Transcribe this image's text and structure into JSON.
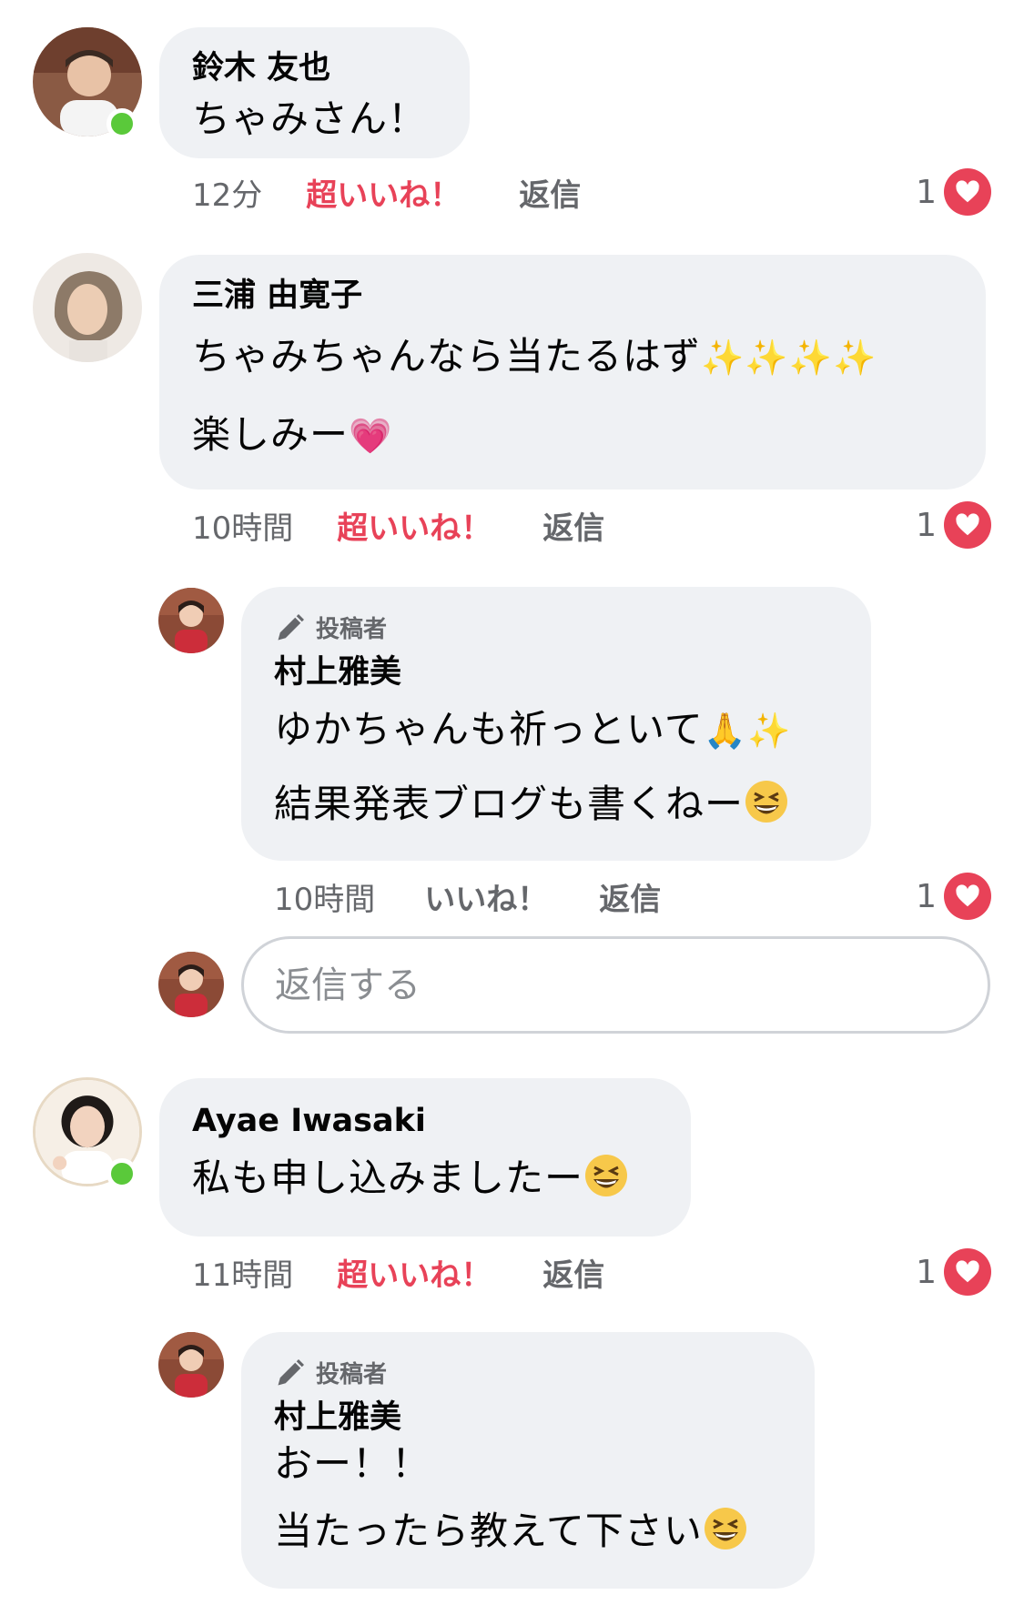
{
  "colors": {
    "like_accent": "#e84258",
    "online": "#5ac93a",
    "bubble": "#eff1f4",
    "muted": "#65676b"
  },
  "comments": [
    {
      "name": "鈴木 友也",
      "lines": [
        "ちゃみさん！"
      ],
      "time": "12分",
      "like_label": "超いいね！",
      "reply_label": "返信",
      "reaction_count": "1"
    },
    {
      "name": "三浦 由寛子",
      "lines": [
        "ちゃみちゃんなら当たるはず",
        "楽しみー"
      ],
      "time": "10時間",
      "like_label": "超いいね！",
      "reply_label": "返信",
      "reaction_count": "1"
    },
    {
      "badge": "投稿者",
      "name": "村上雅美",
      "lines": [
        "ゆかちゃんも祈っといて",
        "結果発表ブログも書くねー"
      ],
      "time": "10時間",
      "like_label": "いいね！",
      "reply_label": "返信",
      "reaction_count": "1"
    },
    {
      "name": "Ayae Iwasaki",
      "lines": [
        "私も申し込みましたー"
      ],
      "time": "11時間",
      "like_label": "超いいね！",
      "reply_label": "返信",
      "reaction_count": "1"
    },
    {
      "badge": "投稿者",
      "name": "村上雅美",
      "lines": [
        "おー！！",
        "当たったら教えて下さい"
      ]
    }
  ],
  "reply_input": {
    "placeholder": "返信する"
  },
  "icons": {
    "heart": "heart-icon",
    "pencil": "pencil-icon",
    "online": "online-status-icon",
    "sparkles": "sparkles-emoji",
    "grin": "grinning-squinting-face-emoji",
    "pray": "folded-hands-emoji",
    "pink_heart": "growing-heart-emoji"
  }
}
